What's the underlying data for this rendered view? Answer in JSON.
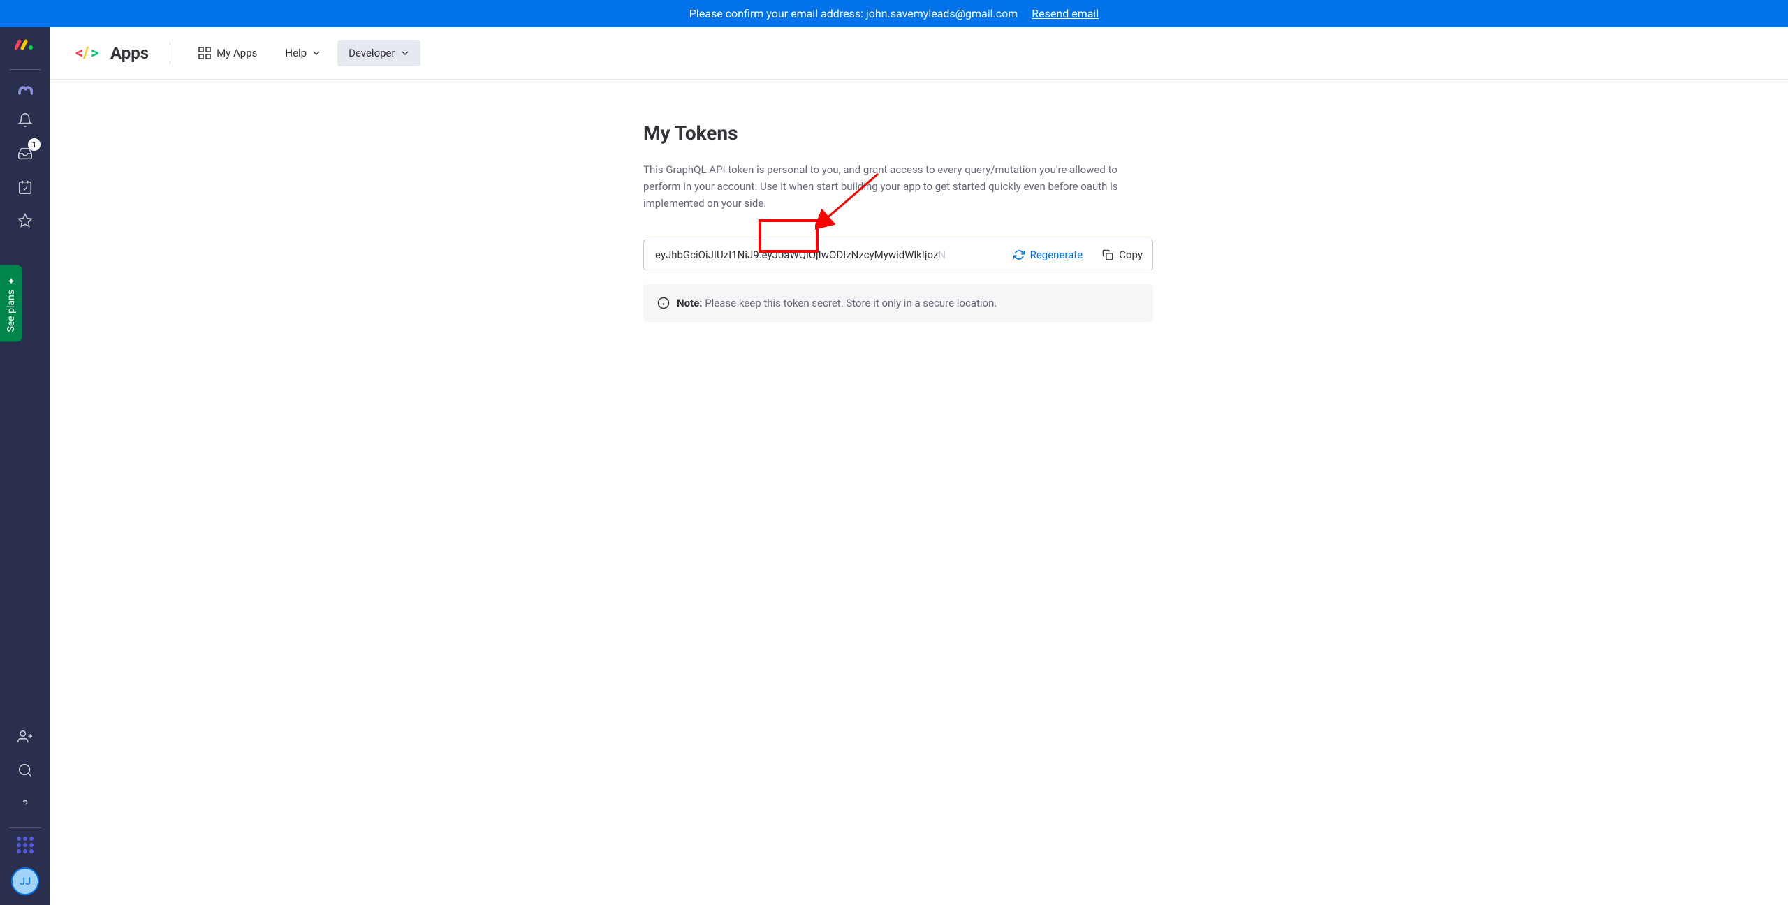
{
  "banner": {
    "text": "Please confirm your email address: john.savemyleads@gmail.com",
    "link_text": "Resend email"
  },
  "sidebar": {
    "inbox_badge": "1",
    "see_plans": "See plans",
    "avatar_initials": "JJ"
  },
  "nav": {
    "brand": "Apps",
    "my_apps": "My Apps",
    "help": "Help",
    "developer": "Developer"
  },
  "page": {
    "title": "My Tokens",
    "description": "This GraphQL API token is personal to you, and grant access to every query/mutation you're allowed to perform in your account. Use it when start building your app to get started quickly even before oauth is implemented on your side.",
    "token_value": "eyJhbGciOiJIUzI1NiJ9.eyJ0aWQiOjIwODIzNzcyMywidWlkIjoz",
    "regenerate": "Regenerate",
    "copy": "Copy",
    "note_label": "Note:",
    "note_text": "Please keep this token secret. Store it only in a secure location."
  }
}
